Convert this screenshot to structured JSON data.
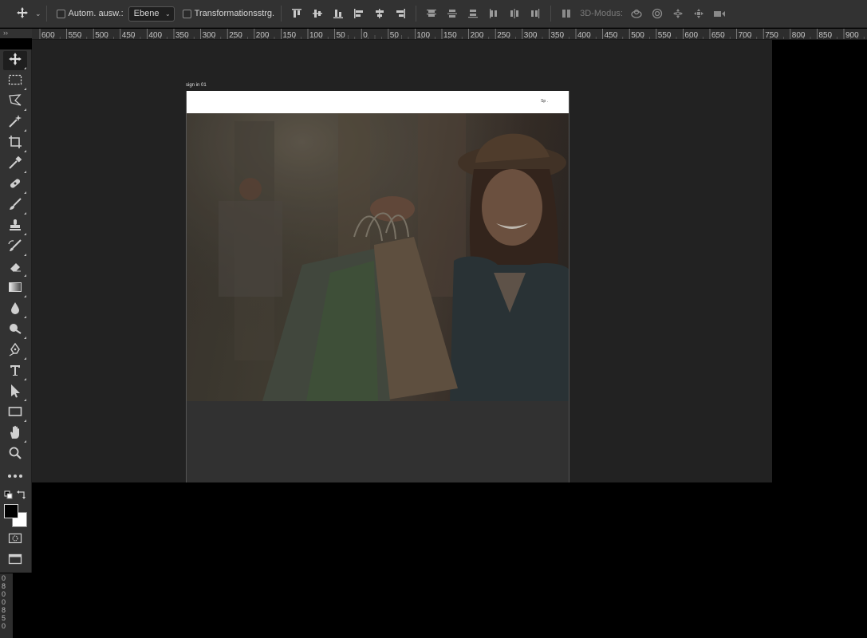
{
  "options_bar": {
    "auto_select_label": "Autom. ausw.:",
    "layer_select_value": "Ebene",
    "transform_label": "Transformationsstrg.",
    "mode3d_label": "3D-Modus:"
  },
  "panel_collapse": "››",
  "ruler": {
    "h_labels": [
      "600",
      "550",
      "500",
      "450",
      "400",
      "350",
      "300",
      "250",
      "200",
      "150",
      "100",
      "50",
      "0",
      "50",
      "100",
      "150",
      "200",
      "250",
      "300",
      "350",
      "400",
      "450",
      "500",
      "550",
      "600",
      "650",
      "700",
      "750",
      "800",
      "850",
      "900"
    ],
    "v_digits": [
      "0",
      "8",
      "0",
      "0",
      "8",
      "5",
      "0"
    ]
  },
  "document": {
    "label": "sign in 01",
    "header_text": "Sp ."
  },
  "colors": {
    "app_bg": "#323232",
    "pasteboard": "#222222",
    "foreground_swatch": "#000000",
    "background_swatch": "#ffffff"
  },
  "icons": {
    "toolbar": [
      "move-tool-icon",
      "marquee-tool-icon",
      "lasso-tool-icon",
      "magic-wand-icon",
      "crop-tool-icon",
      "eyedropper-icon",
      "healing-brush-icon",
      "brush-tool-icon",
      "clone-stamp-icon",
      "history-brush-icon",
      "eraser-icon",
      "gradient-icon",
      "blur-icon",
      "dodge-icon",
      "pen-tool-icon",
      "type-tool-icon",
      "path-selection-icon",
      "rectangle-tool-icon",
      "hand-tool-icon",
      "zoom-tool-icon",
      "more-tools-icon"
    ]
  }
}
